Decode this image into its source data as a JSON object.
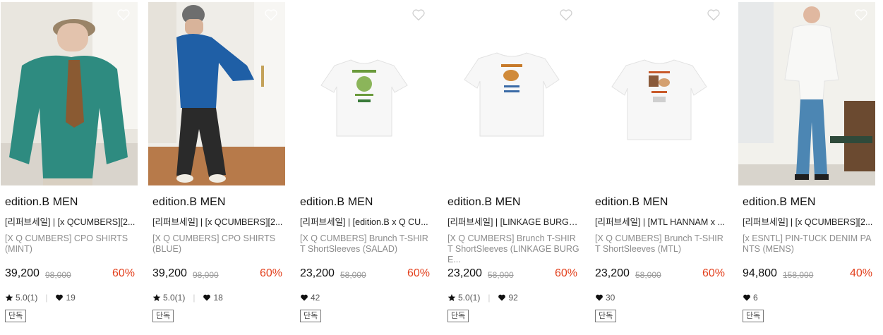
{
  "products": [
    {
      "brand": "edition.B MEN",
      "title": "[리퍼브세일] | [x QCUMBERS][2...",
      "subtitle": "[X Q CUMBERS] CPO SHIRTS (MINT)",
      "price": "39,200",
      "original_price": "98,000",
      "discount": "60%",
      "rating": "5.0(1)",
      "likes": "19",
      "tag": "단독",
      "colors": {
        "bg": "#ece9e3",
        "garment": "#2e8b80"
      }
    },
    {
      "brand": "edition.B MEN",
      "title": "[리퍼브세일] | [x QCUMBERS][2...",
      "subtitle": "[X Q CUMBERS] CPO SHIRTS (BLUE)",
      "price": "39,200",
      "original_price": "98,000",
      "discount": "60%",
      "rating": "5.0(1)",
      "likes": "18",
      "tag": "단독",
      "colors": {
        "bg": "#f1efeb",
        "garment": "#1f5fa6"
      }
    },
    {
      "brand": "edition.B MEN",
      "title": "[리퍼브세일] | [edition.B x Q CU...",
      "subtitle": "[X Q CUMBERS] Brunch T-SHIRT ShortSleeves (SALAD)",
      "price": "23,200",
      "original_price": "58,000",
      "discount": "60%",
      "likes": "42",
      "tag": "단독",
      "colors": {
        "bg": "#ffffff",
        "print": "#6a9a3c"
      }
    },
    {
      "brand": "edition.B MEN",
      "title": "[리퍼브세일] | [LINKAGE BURGE...",
      "subtitle": "[X Q CUMBERS] Brunch T-SHIRT ShortSleeves (LINKAGE BURGE...",
      "price": "23,200",
      "original_price": "58,000",
      "discount": "60%",
      "rating": "5.0(1)",
      "likes": "92",
      "tag": "단독",
      "colors": {
        "bg": "#ffffff",
        "print": "#c77a2a"
      }
    },
    {
      "brand": "edition.B MEN",
      "title": "[리퍼브세일] | [MTL HANNAM x ...",
      "subtitle": "[X Q CUMBERS] Brunch T-SHIRT ShortSleeves (MTL)",
      "price": "23,200",
      "original_price": "58,000",
      "discount": "60%",
      "likes": "30",
      "tag": "단독",
      "colors": {
        "bg": "#ffffff",
        "print": "#c85a2a"
      }
    },
    {
      "brand": "edition.B MEN",
      "title": "[리퍼브세일] | [x QCUMBERS][2...",
      "subtitle": "[x ESNTL] PIN-TUCK DENIM PANTS (MENS)",
      "price": "94,800",
      "original_price": "158,000",
      "discount": "40%",
      "likes": "6",
      "tag": "단독",
      "colors": {
        "bg": "#f3f2ee",
        "garment": "#4c86b3"
      }
    }
  ],
  "icons": {
    "wishlist": "heart-outline-icon",
    "rating": "star-icon",
    "likes": "heart-filled-icon"
  }
}
